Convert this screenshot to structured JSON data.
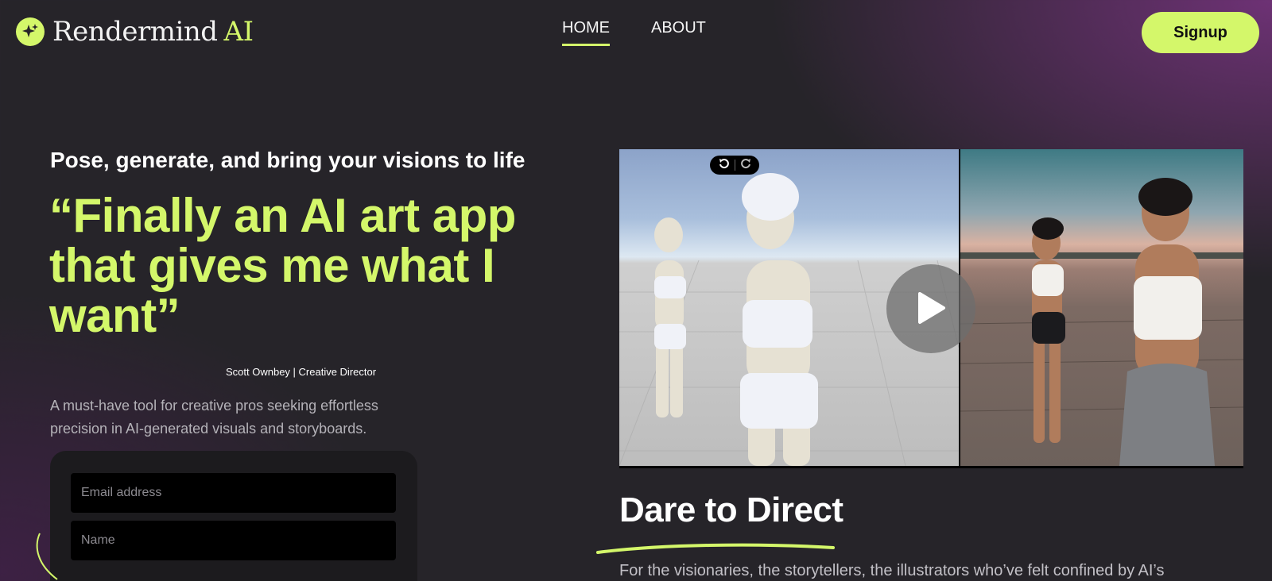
{
  "brand": {
    "name": "Rendermind",
    "accent": "AI",
    "color_accent": "#d4f76a"
  },
  "nav": {
    "items": [
      {
        "label": "HOME",
        "active": true
      },
      {
        "label": "ABOUT",
        "active": false
      }
    ]
  },
  "header": {
    "signup_label": "Signup"
  },
  "hero": {
    "tagline": "Pose, generate, and bring your visions to life",
    "quote": "“Finally an AI art app that gives me what I want”",
    "attribution": "Scott Ownbey | Creative Director",
    "description": "A must-have tool for creative pros seeking effortless precision in AI-generated visuals and storyboards."
  },
  "form": {
    "email_placeholder": "Email address",
    "name_placeholder": "Name"
  },
  "media": {
    "icons": [
      "undo-icon",
      "redo-icon",
      "play-icon"
    ]
  },
  "section": {
    "title": "Dare to Direct",
    "body": "For the visionaries, the storytellers, the illustrators who’ve felt confined by AI’s"
  }
}
